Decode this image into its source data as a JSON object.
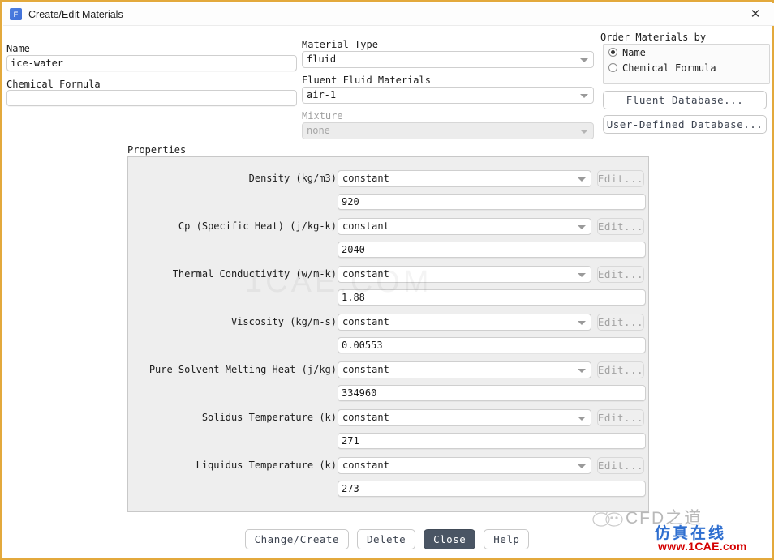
{
  "window": {
    "title": "Create/Edit Materials",
    "icon": "fluent-app-icon",
    "icon_letter": "F",
    "close_label": "✕",
    "border_color": "#e3a93c"
  },
  "left_fields": {
    "name_label": "Name",
    "name_value": "ice-water",
    "formula_label": "Chemical Formula",
    "formula_value": ""
  },
  "middle_fields": {
    "material_type_label": "Material Type",
    "material_type_value": "fluid",
    "fluent_fluid_label": "Fluent Fluid Materials",
    "fluent_fluid_value": "air-1",
    "mixture_label": "Mixture",
    "mixture_value": "none"
  },
  "order_by": {
    "group_label": "Order Materials by",
    "options": [
      {
        "label": "Name",
        "selected": true
      },
      {
        "label": "Chemical Formula",
        "selected": false
      }
    ],
    "fluent_database_button": "Fluent Database...",
    "user_defined_database_button": "User-Defined Database..."
  },
  "properties": {
    "group_label": "Properties",
    "edit_button_label": "Edit...",
    "rows": [
      {
        "label": "Density (kg/m3)",
        "method": "constant",
        "value": "920"
      },
      {
        "label": "Cp (Specific Heat) (j/kg-k)",
        "method": "constant",
        "value": "2040"
      },
      {
        "label": "Thermal Conductivity (w/m-k)",
        "method": "constant",
        "value": "1.88"
      },
      {
        "label": "Viscosity (kg/m-s)",
        "method": "constant",
        "value": "0.00553"
      },
      {
        "label": "Pure Solvent Melting Heat (j/kg)",
        "method": "constant",
        "value": "334960"
      },
      {
        "label": "Solidus Temperature (k)",
        "method": "constant",
        "value": "271"
      },
      {
        "label": "Liquidus Temperature (k)",
        "method": "constant",
        "value": "273"
      }
    ]
  },
  "footer": {
    "buttons": [
      {
        "label": "Change/Create",
        "primary": false
      },
      {
        "label": "Delete",
        "primary": false
      },
      {
        "label": "Close",
        "primary": true
      },
      {
        "label": "Help",
        "primary": false
      }
    ]
  },
  "watermark": {
    "center": "1CAE.COM",
    "brand_cn": "CFD之道",
    "sub_cn": "仿真在线",
    "url": "www.1CAE.com"
  }
}
